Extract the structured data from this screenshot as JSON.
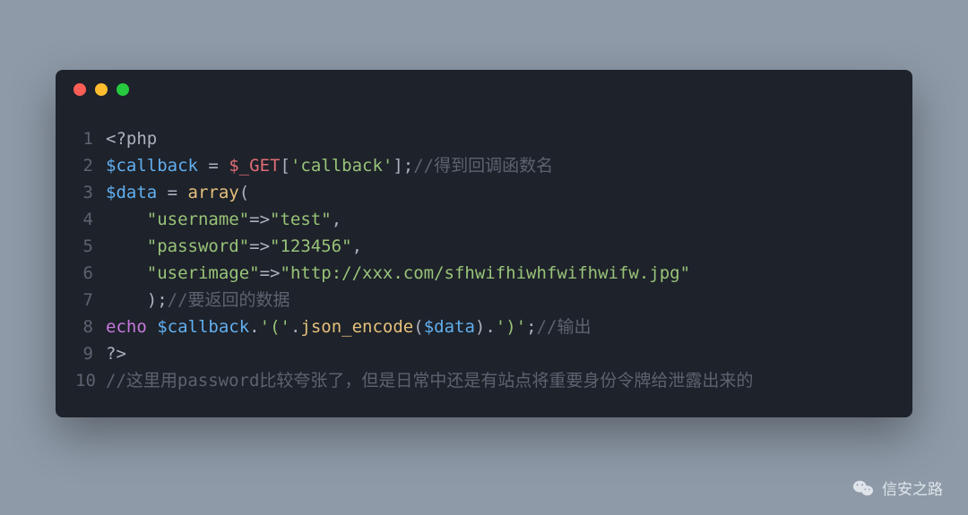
{
  "window": {
    "dots": [
      "red",
      "yellow",
      "green"
    ]
  },
  "code": {
    "lines": [
      {
        "n": "1",
        "tokens": [
          {
            "t": "<?php",
            "c": "tk-default"
          }
        ]
      },
      {
        "n": "2",
        "tokens": [
          {
            "t": "$callback",
            "c": "tk-var"
          },
          {
            "t": " = ",
            "c": "tk-op"
          },
          {
            "t": "$_GET",
            "c": "tk-global"
          },
          {
            "t": "[",
            "c": "tk-punct"
          },
          {
            "t": "'callback'",
            "c": "tk-string"
          },
          {
            "t": "];",
            "c": "tk-punct"
          },
          {
            "t": "//得到回调函数名",
            "c": "tk-comment"
          }
        ]
      },
      {
        "n": "3",
        "tokens": [
          {
            "t": "$data",
            "c": "tk-var"
          },
          {
            "t": " = ",
            "c": "tk-op"
          },
          {
            "t": "array",
            "c": "tk-func"
          },
          {
            "t": "(",
            "c": "tk-punct"
          }
        ]
      },
      {
        "n": "4",
        "tokens": [
          {
            "t": "    ",
            "c": "tk-default"
          },
          {
            "t": "\"username\"",
            "c": "tk-string"
          },
          {
            "t": "=>",
            "c": "tk-op"
          },
          {
            "t": "\"test\"",
            "c": "tk-string"
          },
          {
            "t": ",",
            "c": "tk-punct"
          }
        ]
      },
      {
        "n": "5",
        "tokens": [
          {
            "t": "    ",
            "c": "tk-default"
          },
          {
            "t": "\"password\"",
            "c": "tk-string"
          },
          {
            "t": "=>",
            "c": "tk-op"
          },
          {
            "t": "\"123456\"",
            "c": "tk-string"
          },
          {
            "t": ",",
            "c": "tk-punct"
          }
        ]
      },
      {
        "n": "6",
        "tokens": [
          {
            "t": "    ",
            "c": "tk-default"
          },
          {
            "t": "\"userimage\"",
            "c": "tk-string"
          },
          {
            "t": "=>",
            "c": "tk-op"
          },
          {
            "t": "\"http://xxx.com/sfhwifhiwhfwifhwifw.jpg\"",
            "c": "tk-string"
          }
        ]
      },
      {
        "n": "7",
        "tokens": [
          {
            "t": "    );",
            "c": "tk-punct"
          },
          {
            "t": "//要返回的数据",
            "c": "tk-comment"
          }
        ]
      },
      {
        "n": "8",
        "tokens": [
          {
            "t": "echo",
            "c": "tk-echo"
          },
          {
            "t": " ",
            "c": "tk-default"
          },
          {
            "t": "$callback",
            "c": "tk-var"
          },
          {
            "t": ".",
            "c": "tk-op"
          },
          {
            "t": "'('",
            "c": "tk-string"
          },
          {
            "t": ".",
            "c": "tk-op"
          },
          {
            "t": "json_encode",
            "c": "tk-func"
          },
          {
            "t": "(",
            "c": "tk-punct"
          },
          {
            "t": "$data",
            "c": "tk-var"
          },
          {
            "t": ").",
            "c": "tk-punct"
          },
          {
            "t": "')'",
            "c": "tk-string"
          },
          {
            "t": ";",
            "c": "tk-punct"
          },
          {
            "t": "//输出",
            "c": "tk-comment"
          }
        ]
      },
      {
        "n": "9",
        "tokens": [
          {
            "t": "?>",
            "c": "tk-default"
          }
        ]
      },
      {
        "n": "10",
        "tokens": [
          {
            "t": "//这里用password比较夸张了，但是日常中还是有站点将重要身份令牌给泄露出来的",
            "c": "tk-comment"
          }
        ]
      }
    ]
  },
  "footer": {
    "label": "信安之路"
  }
}
